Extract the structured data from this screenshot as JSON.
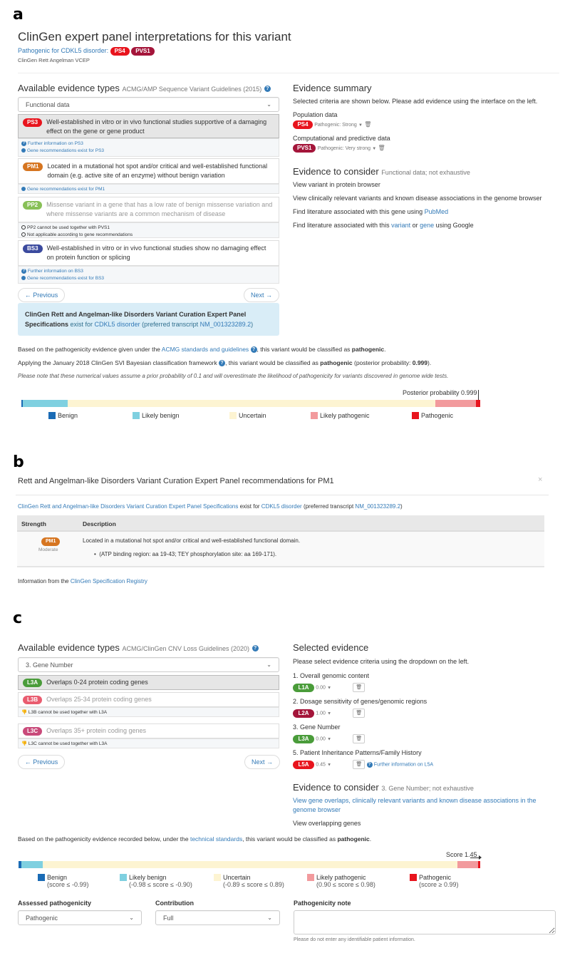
{
  "colors": {
    "link": "#337ab7",
    "pathogenic_strong": "#e8141d",
    "pathogenic_very_strong": "#a4153a",
    "moderate": "#d67520",
    "supporting": "#88c057",
    "benign_strong": "#3b4a9e",
    "l_green": "#4a9c3a",
    "l_red_dark": "#a4153a",
    "l_pink": "#e95c6f",
    "l_magenta": "#c94a7a",
    "benign": "#1a6bb5",
    "likely_benign": "#7fd0e0",
    "uncertain": "#fdf4d2",
    "likely_pathogenic": "#f29a9d",
    "pathogenic": "#e8141d"
  },
  "panel_a": {
    "letter": "a",
    "title": "ClinGen expert panel interpretations for this variant",
    "interpretation_link": "Pathogenic for CDKL5 disorder:",
    "interpretation_badges": [
      "PS4",
      "PVS1"
    ],
    "vcep": "ClinGen Rett Angelman VCEP",
    "left": {
      "heading": "Available evidence types",
      "heading_sub": "ACMG/AMP Sequence Variant Guidelines (2015)",
      "category_select": "Functional data",
      "criteria": [
        {
          "code": "PS3",
          "text": "Well-established in vitro or in vivo functional studies supportive of a damaging effect on the gene or gene product",
          "notes": [
            "Further information on PS3",
            "Gene recommendations exist for PS3"
          ]
        },
        {
          "code": "PM1",
          "text": "Located in a mutational hot spot and/or critical and well-established functional domain (e.g. active site of an enzyme) without benign variation",
          "notes": [
            "Gene recommendations exist for PM1"
          ]
        },
        {
          "code": "PP2",
          "text": "Missense variant in a gene that has a low rate of benign missense variation and where missense variants are a common mechanism of disease",
          "notes": [
            "PP2 cannot be used together with PVS1",
            "Not applicable according to gene recommendations"
          ]
        },
        {
          "code": "BS3",
          "text": "Well-established in vitro or in vivo functional studies show no damaging effect on protein function or splicing",
          "notes": [
            "Further information on BS3",
            "Gene recommendations exist for BS3"
          ]
        }
      ],
      "prev_label": "← Previous",
      "next_label": "Next →",
      "info_bold": "ClinGen Rett and Angelman-like Disorders Variant Curation Expert Panel Specifications",
      "info_exist": " exist for ",
      "info_disorder": "CDKL5 disorder",
      "info_pref": " (preferred transcript ",
      "info_transcript": "NM_001323289.2",
      "info_close": ")"
    },
    "right": {
      "heading": "Evidence summary",
      "intro": "Selected criteria are shown below. Please add evidence using the interface on the left.",
      "groups": [
        {
          "label": "Population data",
          "code": "PS4",
          "strength": "Pathogenic: Strong"
        },
        {
          "label": "Computational and predictive data",
          "code": "PVS1",
          "strength": "Pathogenic: Very strong"
        }
      ],
      "consider_heading": "Evidence to consider",
      "consider_sub": "Functional data; not exhaustive",
      "link1": "View variant in protein browser",
      "link2": "View clinically relevant variants and known disease associations in the genome browser",
      "lit1_pre": "Find literature associated with this gene using ",
      "lit1_link": "PubMed",
      "lit2_pre": "Find literature associated with this ",
      "lit2_link1": "variant",
      "lit2_mid": " or ",
      "lit2_link2": "gene",
      "lit2_post": " using Google"
    },
    "summary": {
      "line1_pre": "Based on the pathogenicity evidence given under the ",
      "line1_link": "ACMG standards and guidelines",
      "line1_post": ", this variant would be classified as ",
      "line1_bold": "pathogenic",
      "line2_pre": "Applying the January 2018 ClinGen SVI Bayesian classification framework ",
      "line2_post": ", this variant would be classified as ",
      "line2_bold": "pathogenic",
      "line2_post2": " (posterior probability: ",
      "line2_value": "0.999",
      "line2_close": ").",
      "note": "Please note that these numerical values assume a prior probability of 0.1 and will overestimate the likelihood of pathogenicity for variants discovered in genome wide tests."
    },
    "scale": {
      "marker_label": "Posterior probability 0.999",
      "posterior_probability": 0.999,
      "legend": [
        "Benign",
        "Likely benign",
        "Uncertain",
        "Likely pathogenic",
        "Pathogenic"
      ]
    }
  },
  "panel_b": {
    "letter": "b",
    "title": "Rett and Angelman-like Disorders Variant Curation Expert Panel recommendations for PM1",
    "close": "×",
    "spec_link": "ClinGen Rett and Angelman-like Disorders Variant Curation Expert Panel Specifications",
    "spec_exist": " exist for ",
    "spec_disorder": "CDKL5 disorder",
    "spec_pref": " (preferred transcript ",
    "spec_transcript": "NM_001323289.2",
    "spec_close": ")",
    "columns": [
      "Strength",
      "Description"
    ],
    "row": {
      "code": "PM1",
      "strength": "Moderate",
      "description": "Located in a mutational hot spot and/or critical and well-established functional domain.",
      "bullet": "(ATP binding region: aa 19-43; TEY phosphorylation site: aa 169-171)."
    },
    "footer_pre": "Information from the ",
    "footer_link": "ClinGen Specification Registry"
  },
  "panel_c": {
    "letter": "c",
    "left": {
      "heading": "Available evidence types",
      "heading_sub": "ACMG/ClinGen CNV Loss Guidelines (2020)",
      "category_select": "3. Gene Number",
      "criteria": [
        {
          "code": "L3A",
          "text": "Overlaps 0-24 protein coding genes",
          "note": ""
        },
        {
          "code": "L3B",
          "text": "Overlaps 25-34 protein coding genes",
          "note": "L3B cannot be used together with L3A"
        },
        {
          "code": "L3C",
          "text": "Overlaps 35+ protein coding genes",
          "note": "L3C cannot be used together with L3A"
        }
      ],
      "prev_label": "← Previous",
      "next_label": "Next →"
    },
    "right": {
      "heading": "Selected evidence",
      "intro": "Please select evidence criteria using the dropdown on the left.",
      "groups": [
        {
          "label": "1. Overall genomic content",
          "code": "L1A",
          "score": "0.00"
        },
        {
          "label": "2. Dosage sensitivity of genes/genomic regions",
          "code": "L2A",
          "score": "1.00"
        },
        {
          "label": "3. Gene Number",
          "code": "L3A",
          "score": "0.00"
        },
        {
          "label": "5. Patient Inheritance Patterns/Family History",
          "code": "L5A",
          "score": "0.45",
          "info": "Further information on L5A"
        }
      ],
      "consider_heading": "Evidence to consider",
      "consider_sub": "3. Gene Number; not exhaustive",
      "link1": "View gene overlaps, clinically relevant variants and known disease associations in the genome browser",
      "link2": "View overlapping genes"
    },
    "summary": {
      "pre": "Based on the pathogenicity evidence recorded below, under the ",
      "link": "technical standards",
      "post": ", this variant would be classified as ",
      "bold": "pathogenic",
      "end": "."
    },
    "scale": {
      "marker_label": "Score 1.45",
      "score": 1.45,
      "legend": [
        {
          "label": "Benign",
          "range": "(score ≤ -0.99)"
        },
        {
          "label": "Likely benign",
          "range": "(-0.98 ≤ score ≤ -0.90)"
        },
        {
          "label": "Uncertain",
          "range": "(-0.89 ≤ score ≤ 0.89)"
        },
        {
          "label": "Likely pathogenic",
          "range": "(0.90 ≤ score ≤ 0.98)"
        },
        {
          "label": "Pathogenic",
          "range": "(score ≥ 0.99)"
        }
      ]
    },
    "form": {
      "assessed_label": "Assessed pathogenicity",
      "assessed_value": "Pathogenic",
      "contribution_label": "Contribution",
      "contribution_value": "Full",
      "note_label": "Pathogenicity note",
      "note_value": "",
      "note_help": "Please do not enter any identifiable patient information."
    }
  }
}
